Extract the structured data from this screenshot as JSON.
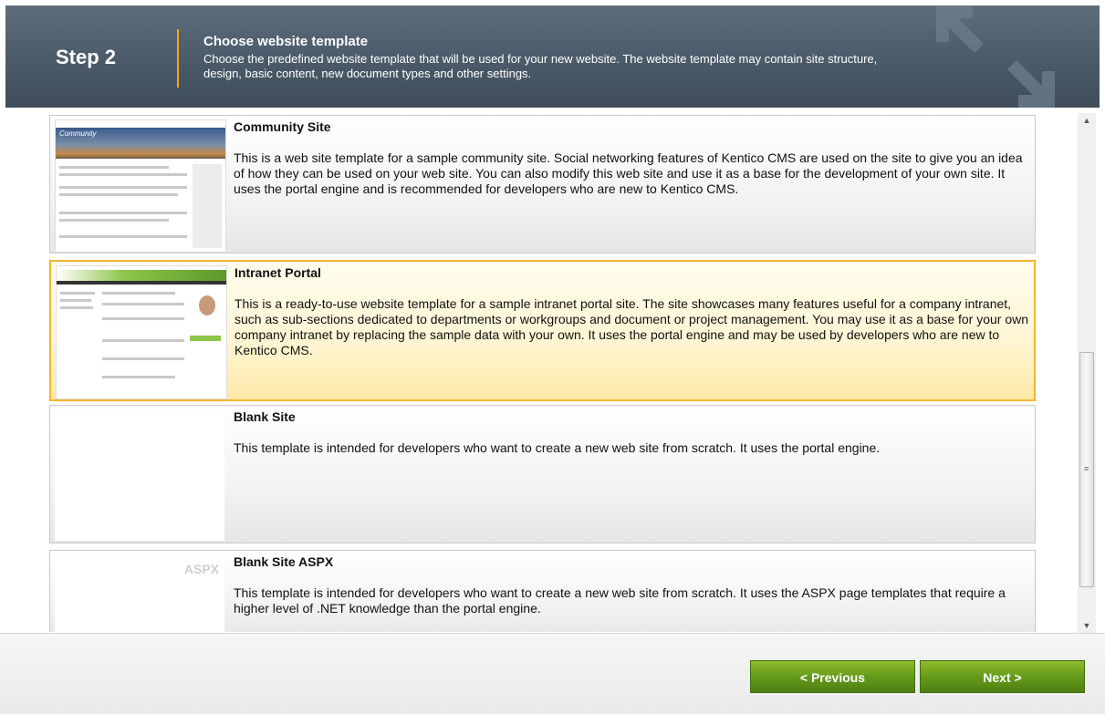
{
  "header": {
    "step": "Step 2",
    "title": "Choose website template",
    "description": "Choose the predefined website template that will be used for your new website. The website template may contain site structure, design, basic content, new document types and other settings."
  },
  "templates": [
    {
      "title": "Community Site",
      "description": "This is a web site template for a sample community site. Social networking features of Kentico CMS are used on the site to give you an idea of how they can be used on your web site. You can also modify this web site and use it as a base for the development of your own site. It uses the portal engine and is recommended for developers who are new to Kentico CMS.",
      "thumb_label": "Community",
      "selected": false
    },
    {
      "title": "Intranet Portal",
      "description": "This is a ready-to-use website template for a sample intranet portal site. The site showcases many features useful for a company intranet, such as sub-sections dedicated to departments or workgroups and document or project management. You may use it as a base for your own company intranet by replacing the sample data with your own. It uses the portal engine and may be used by developers who are new to Kentico CMS.",
      "selected": true
    },
    {
      "title": "Blank Site",
      "description": "This template is intended for developers who want to create a new web site from scratch. It uses the portal engine.",
      "selected": false
    },
    {
      "title": "Blank Site ASPX",
      "description": "This template is intended for developers who want to create a new web site from scratch. It uses the ASPX page templates that require a higher level of .NET knowledge than the portal engine.",
      "thumb_label": "ASPX",
      "selected": false
    }
  ],
  "footer": {
    "previous_label": "< Previous",
    "next_label": "Next >"
  },
  "colors": {
    "accent": "#f0a818",
    "button_green": "#659a1a",
    "selected_border": "#f3b52d"
  }
}
